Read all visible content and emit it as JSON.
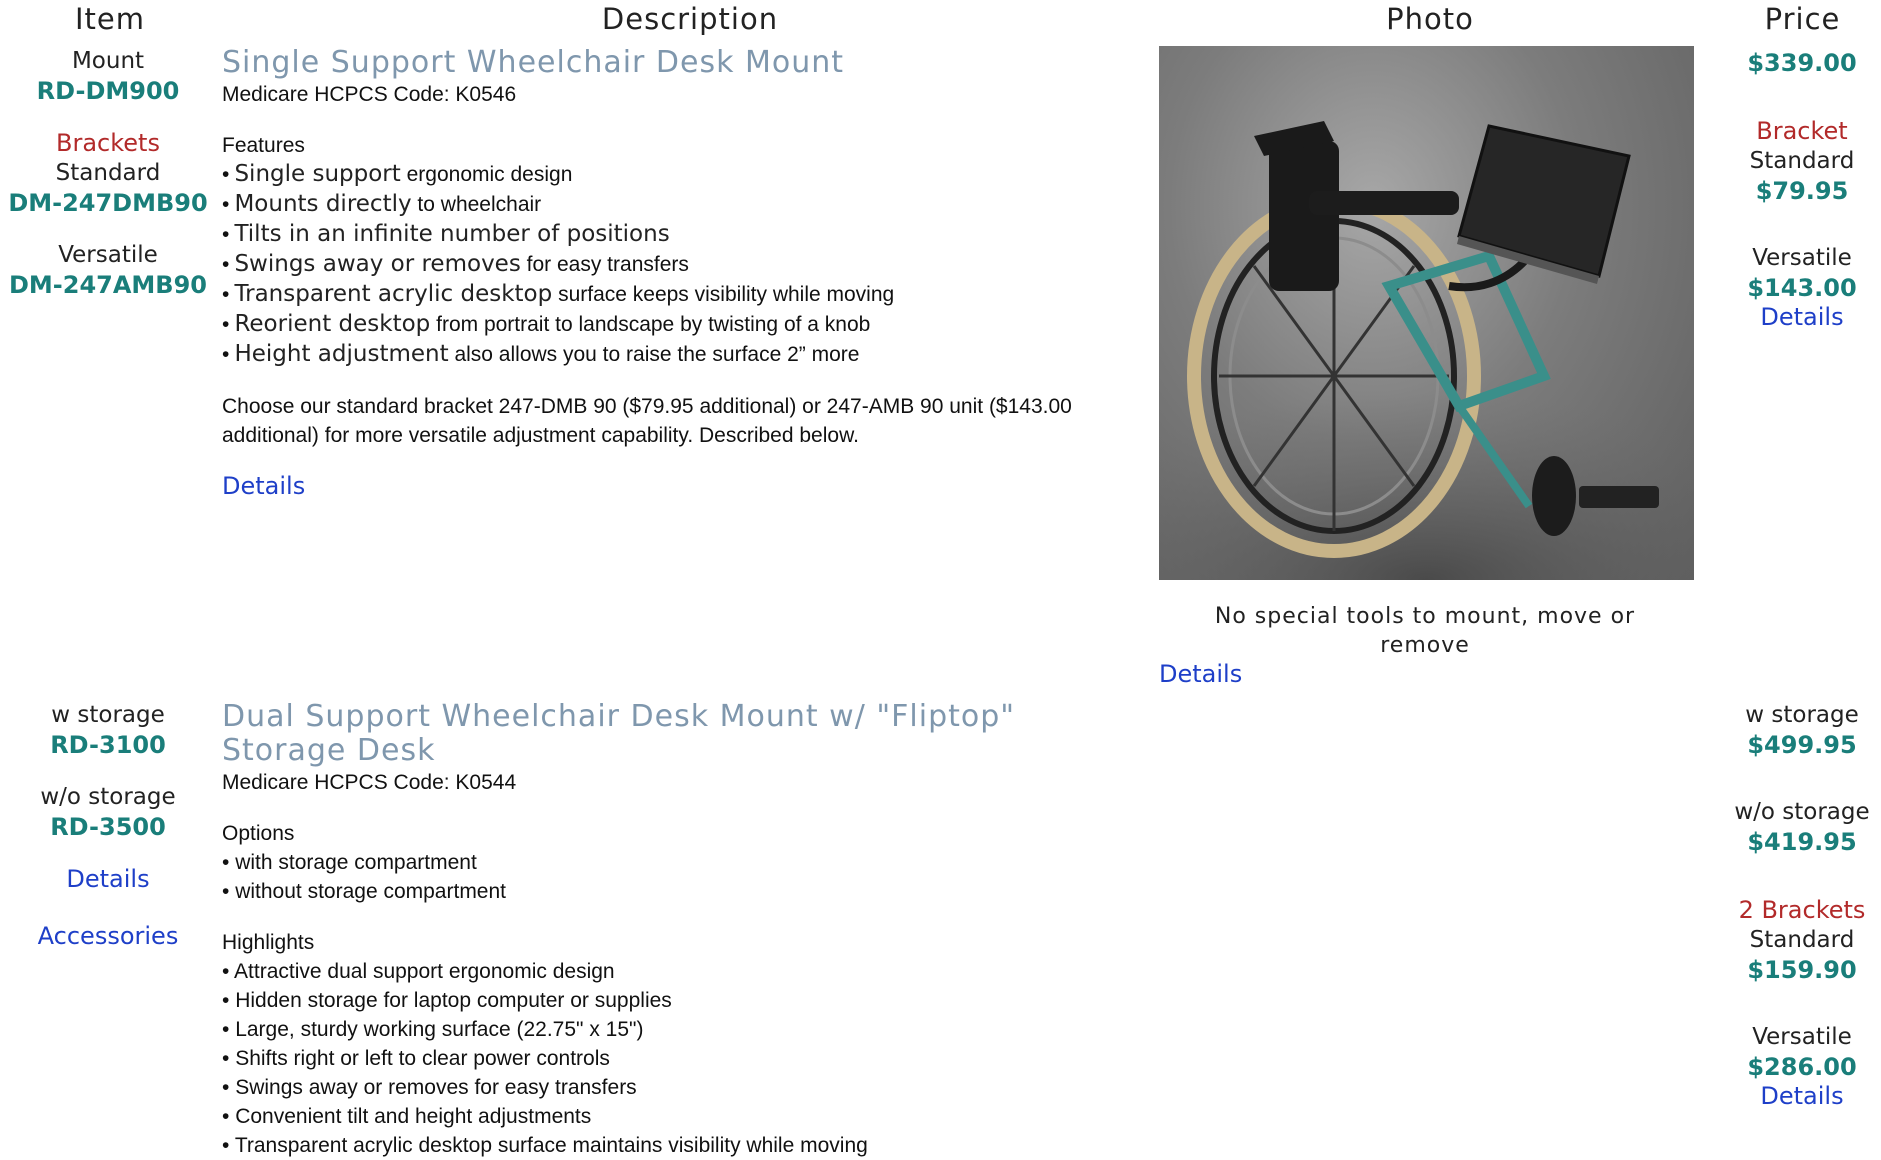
{
  "headers": {
    "item": "Item",
    "description": "Description",
    "photo": "Photo",
    "price": "Price"
  },
  "row1": {
    "item": {
      "mount_label": "Mount",
      "mount_sku": "RD-DM900",
      "brackets_label": "Brackets",
      "standard_label": "Standard",
      "standard_sku": "DM-247DMB90",
      "versatile_label": "Versatile",
      "versatile_sku": "DM-247AMB90"
    },
    "title": "Single Support Wheelchair Desk Mount",
    "hcpcs": "Medicare HCPCS Code: K0546",
    "features_label": "Features",
    "features": [
      {
        "lead": "Single support",
        "rest": " ergonomic design"
      },
      {
        "lead": "Mounts directly",
        "rest": " to wheelchair"
      },
      {
        "lead": "Tilts in an infinite number of positions",
        "rest": ""
      },
      {
        "lead": "Swings away or removes",
        "rest": " for easy transfers"
      },
      {
        "lead": "Transparent acrylic desktop",
        "rest": " surface keeps visibility while moving"
      },
      {
        "lead": "Reorient desktop",
        "rest": " from portrait to landscape by twisting of a knob"
      },
      {
        "lead": "Height adjustment",
        "rest": " also allows you to raise the surface 2” more"
      }
    ],
    "choose_text": "Choose our standard bracket 247-DMB 90 ($79.95 additional) or 247-AMB 90 unit ($143.00 additional) for more versatile adjustment capability. Described below.",
    "details_link": "Details",
    "photo_caption": "No special tools to mount, move or remove",
    "photo_details_link": "Details",
    "price": {
      "mount_price": "$339.00",
      "bracket_label": "Bracket",
      "standard_label": "Standard",
      "standard_price": "$79.95",
      "versatile_label": "Versatile",
      "versatile_price": "$143.00",
      "details_link": "Details"
    }
  },
  "row2": {
    "item": {
      "with_label": "w storage",
      "with_sku": "RD-3100",
      "without_label": "w/o storage",
      "without_sku": "RD-3500",
      "details_link": "Details",
      "accessories_link": "Accessories"
    },
    "title": "Dual Support Wheelchair Desk Mount w/ \"Fliptop\" Storage Desk",
    "hcpcs": "Medicare HCPCS Code: K0544",
    "options_label": "Options",
    "options": [
      "with storage compartment",
      "without storage compartment"
    ],
    "highlights_label": "Highlights",
    "highlights": [
      "Attractive dual support ergonomic design",
      "Hidden storage for laptop computer or supplies",
      "Large, sturdy working surface (22.75\" x 15\")",
      "Shifts right or left to clear power controls",
      "Swings away or removes for easy transfers",
      "Convenient tilt and height adjustments",
      "Transparent acrylic desktop surface maintains visibility while moving"
    ],
    "price": {
      "with_label": "w storage",
      "with_price": "$499.95",
      "without_label": "w/o storage",
      "without_price": "$419.95",
      "brackets_label": "2 Brackets",
      "standard_label": "Standard",
      "standard_price": "$159.90",
      "versatile_label": "Versatile",
      "versatile_price": "$286.00",
      "details_link": "Details"
    }
  },
  "bullet_char": "•"
}
